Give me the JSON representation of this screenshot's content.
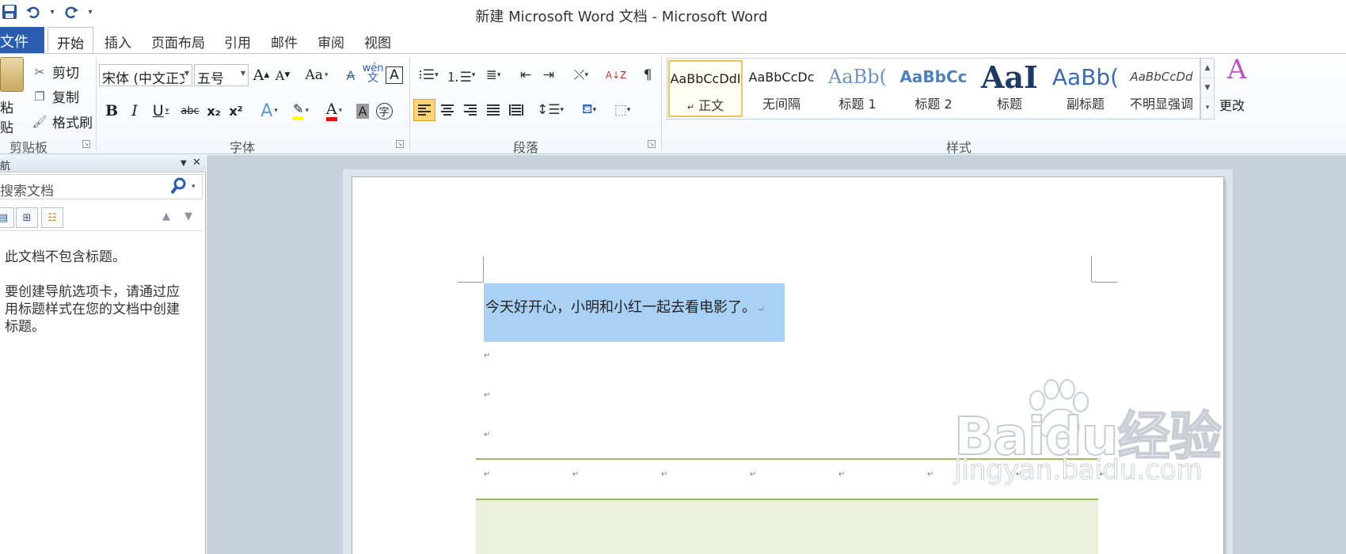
{
  "window": {
    "title": "新建 Microsoft Word 文档 - Microsoft Word"
  },
  "qat": {
    "save_icon": "save-icon",
    "undo_icon": "undo-icon",
    "redo_icon": "redo-icon",
    "more": "▾"
  },
  "tabs": {
    "file": "文件",
    "items": [
      "开始",
      "插入",
      "页面布局",
      "引用",
      "邮件",
      "审阅",
      "视图"
    ]
  },
  "ribbon": {
    "clipboard": {
      "paste": "粘贴",
      "cut": "剪切",
      "copy": "复制",
      "format_painter": "格式刷",
      "group": "剪贴板"
    },
    "font": {
      "family": "宋体 (中文正文)",
      "size": "五号",
      "group": "字体",
      "grow": "A",
      "shrink": "A",
      "case": "Aa",
      "clear": "A",
      "phonetic": "wén",
      "border": "A",
      "bold": "B",
      "italic": "I",
      "underline": "U",
      "strike": "abc",
      "subscript": "x₂",
      "superscript": "x²",
      "effects": "A",
      "highlight": "✎",
      "color": "A",
      "shading": "A",
      "enclose": "字",
      "highlight_color": "#ffff00",
      "font_color": "#e01010"
    },
    "paragraph": {
      "group": "段落",
      "sort": "A↓Z"
    },
    "styles": {
      "group": "样式",
      "items": [
        {
          "preview": "AaBbCcDdI",
          "name": "正文",
          "mark": "↵"
        },
        {
          "preview": "AaBbCcDc",
          "name": "无间隔"
        },
        {
          "preview": "AaBb(",
          "name": "标题 1"
        },
        {
          "preview": "AaBbCc",
          "name": "标题 2"
        },
        {
          "preview": "AaI",
          "name": "标题"
        },
        {
          "preview": "AaBb(",
          "name": "副标题"
        },
        {
          "preview": "AaBbCcDd",
          "name": "不明显强调"
        }
      ],
      "change_styles": "更改"
    }
  },
  "nav": {
    "title": "航",
    "search_placeholder": "搜索文档",
    "msg1": "此文档不包含标题。",
    "msg2": "要创建导航选项卡，请通过应用标题样式在您的文档中创建标题。"
  },
  "document": {
    "selected_text": "今天好开心，小明和小红一起去看电影了。",
    "paragraph_mark": "↵"
  },
  "watermark": {
    "main": "Baidu经验",
    "sub": "jingyan.baidu.com"
  }
}
